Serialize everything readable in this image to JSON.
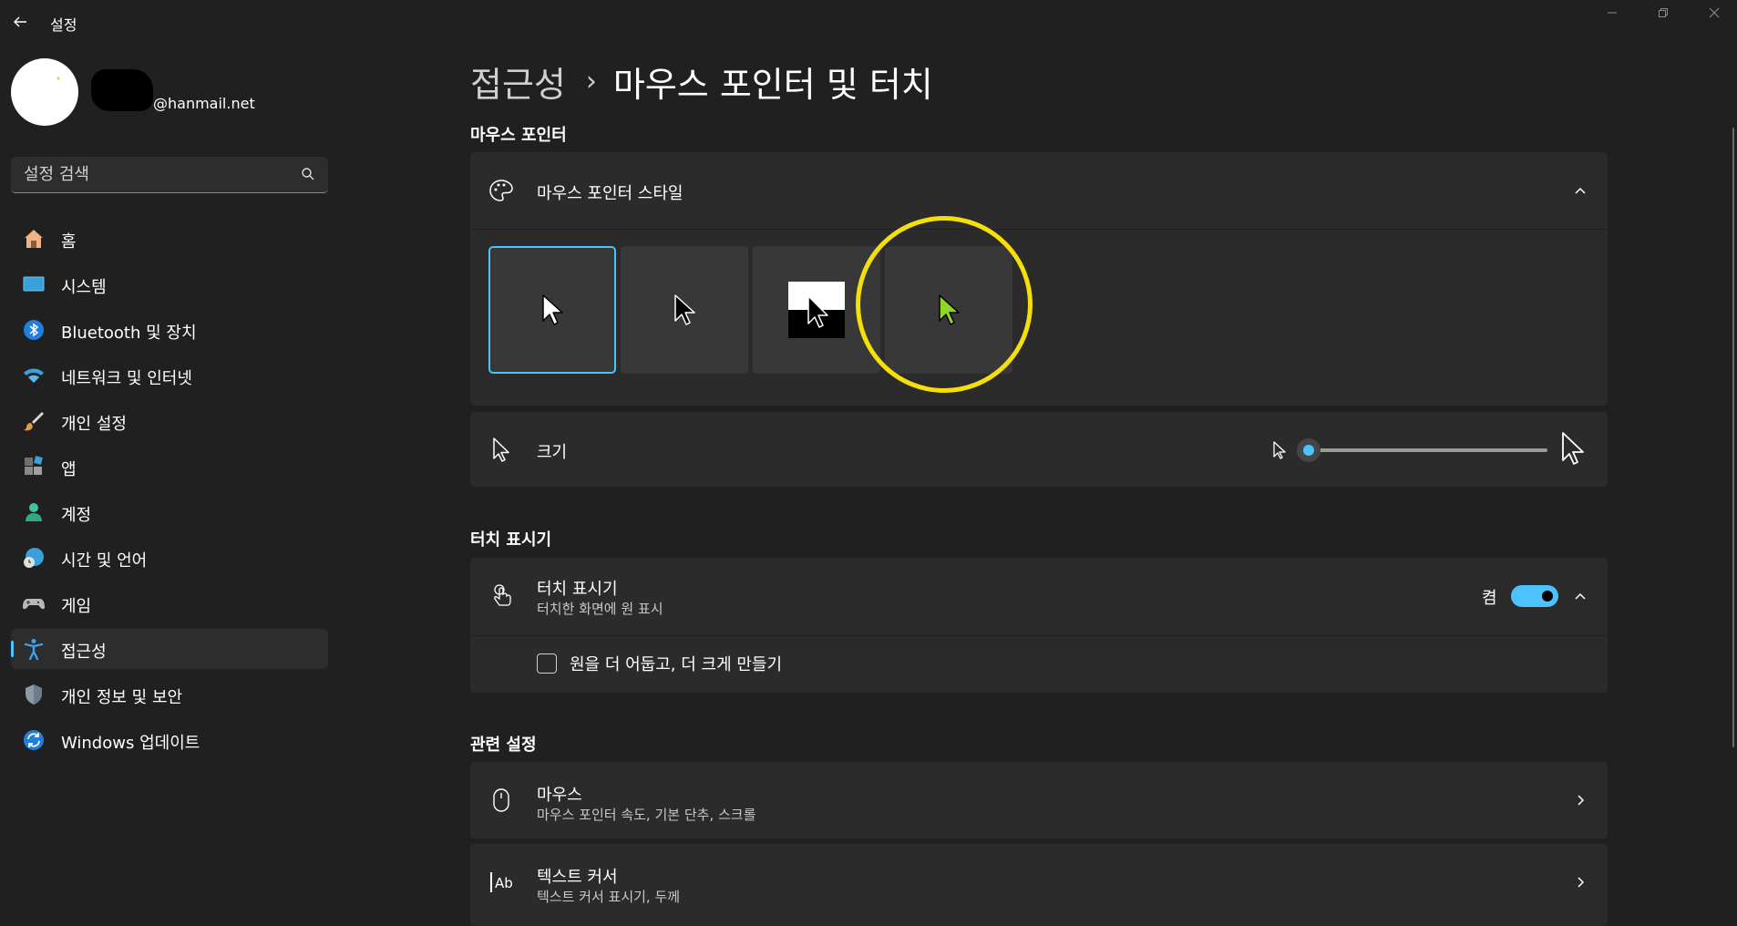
{
  "titlebar": {
    "app_title": "설정"
  },
  "profile": {
    "email": "@hanmail.net"
  },
  "search": {
    "placeholder": "설정 검색"
  },
  "sidebar": {
    "items": [
      {
        "label": "홈",
        "icon": "home-icon"
      },
      {
        "label": "시스템",
        "icon": "system-icon"
      },
      {
        "label": "Bluetooth 및 장치",
        "icon": "bluetooth-icon"
      },
      {
        "label": "네트워크 및 인터넷",
        "icon": "wifi-icon"
      },
      {
        "label": "개인 설정",
        "icon": "brush-icon"
      },
      {
        "label": "앱",
        "icon": "apps-icon"
      },
      {
        "label": "계정",
        "icon": "account-icon"
      },
      {
        "label": "시간 및 언어",
        "icon": "globe-clock-icon"
      },
      {
        "label": "게임",
        "icon": "gamepad-icon"
      },
      {
        "label": "접근성",
        "icon": "accessibility-icon",
        "selected": true
      },
      {
        "label": "개인 정보 및 보안",
        "icon": "shield-icon"
      },
      {
        "label": "Windows 업데이트",
        "icon": "update-icon"
      }
    ]
  },
  "breadcrumb": {
    "parent": "접근성",
    "separator": "›",
    "current": "마우스 포인터 및 터치"
  },
  "mouse_pointer": {
    "section_title": "마우스 포인터",
    "style_card_title": "마우스 포인터 스타일",
    "styles": [
      {
        "name": "white",
        "selected": true
      },
      {
        "name": "black",
        "selected": false
      },
      {
        "name": "inverted",
        "selected": false
      },
      {
        "name": "custom-green",
        "selected": false
      }
    ],
    "size_label": "크기",
    "size_value": 0
  },
  "touch": {
    "section_title": "터치 표시기",
    "card_title": "터치 표시기",
    "card_subtitle": "터치한 화면에 원 표시",
    "toggle_label": "켬",
    "toggle_on": true,
    "checkbox_label": "원을 더 어둡고, 더 크게 만들기",
    "checkbox_checked": false
  },
  "related": {
    "section_title": "관련 설정",
    "items": [
      {
        "title": "마우스",
        "subtitle": "마우스 포인터 속도, 기본 단추, 스크롤",
        "icon": "mouse-icon"
      },
      {
        "title": "텍스트 커서",
        "subtitle": "텍스트 커서 표시기, 두께",
        "icon": "text-cursor-icon"
      }
    ]
  },
  "colors": {
    "accent": "#4cc2ff",
    "highlight_circle": "#f4df0b",
    "background": "#202020",
    "card": "#2b2b2b"
  }
}
